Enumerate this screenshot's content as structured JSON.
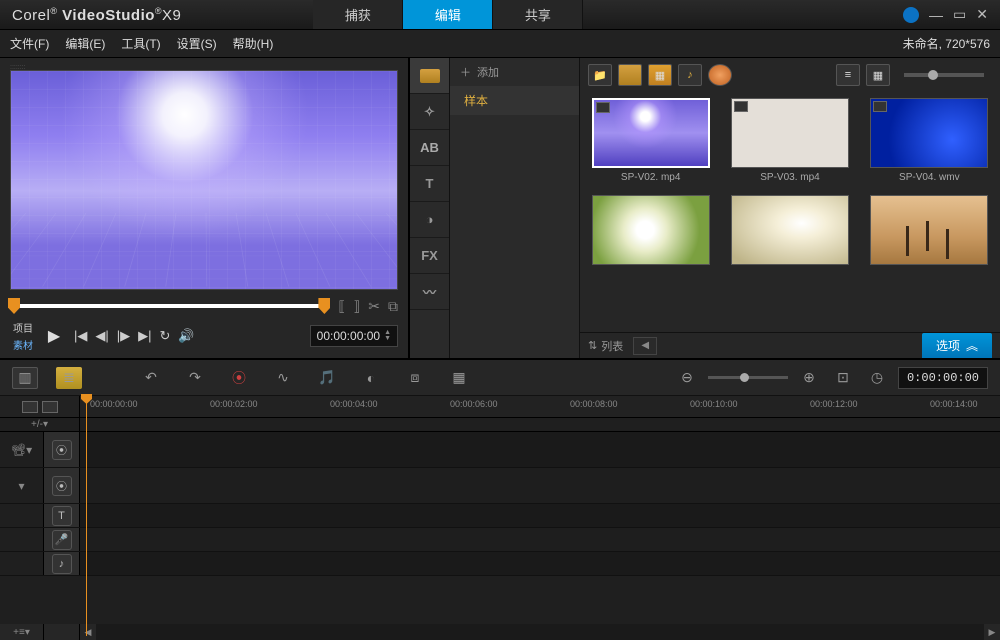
{
  "app": {
    "brand": "Corel",
    "name": "VideoStudio",
    "version": "X9"
  },
  "modes": {
    "capture": "捕获",
    "edit": "编辑",
    "share": "共享",
    "active": "edit"
  },
  "menu": {
    "file": "文件(F)",
    "edit": "编辑(E)",
    "tools": "工具(T)",
    "settings": "设置(S)",
    "help": "帮助(H)"
  },
  "project": {
    "name": "未命名",
    "resolution": "720*576"
  },
  "preview": {
    "mode_project": "项目",
    "mode_clip": "素材",
    "timecode": "00:00:00:00"
  },
  "library": {
    "add": "添加",
    "folder": "样本",
    "footer_sort": "列表",
    "options": "选项",
    "clips": [
      {
        "name": "SP-V02. mp4"
      },
      {
        "name": "SP-V03. mp4"
      },
      {
        "name": "SP-V04. wmv"
      },
      {
        "name": ""
      },
      {
        "name": ""
      },
      {
        "name": ""
      }
    ]
  },
  "timeline": {
    "timecode": "0:00:00:00",
    "ruler": [
      "00:00:00:00",
      "00:00:02:00",
      "00:00:04:00",
      "00:00:06:00",
      "00:00:08:00",
      "00:00:10:00",
      "00:00:12:00",
      "00:00:14:00"
    ]
  }
}
